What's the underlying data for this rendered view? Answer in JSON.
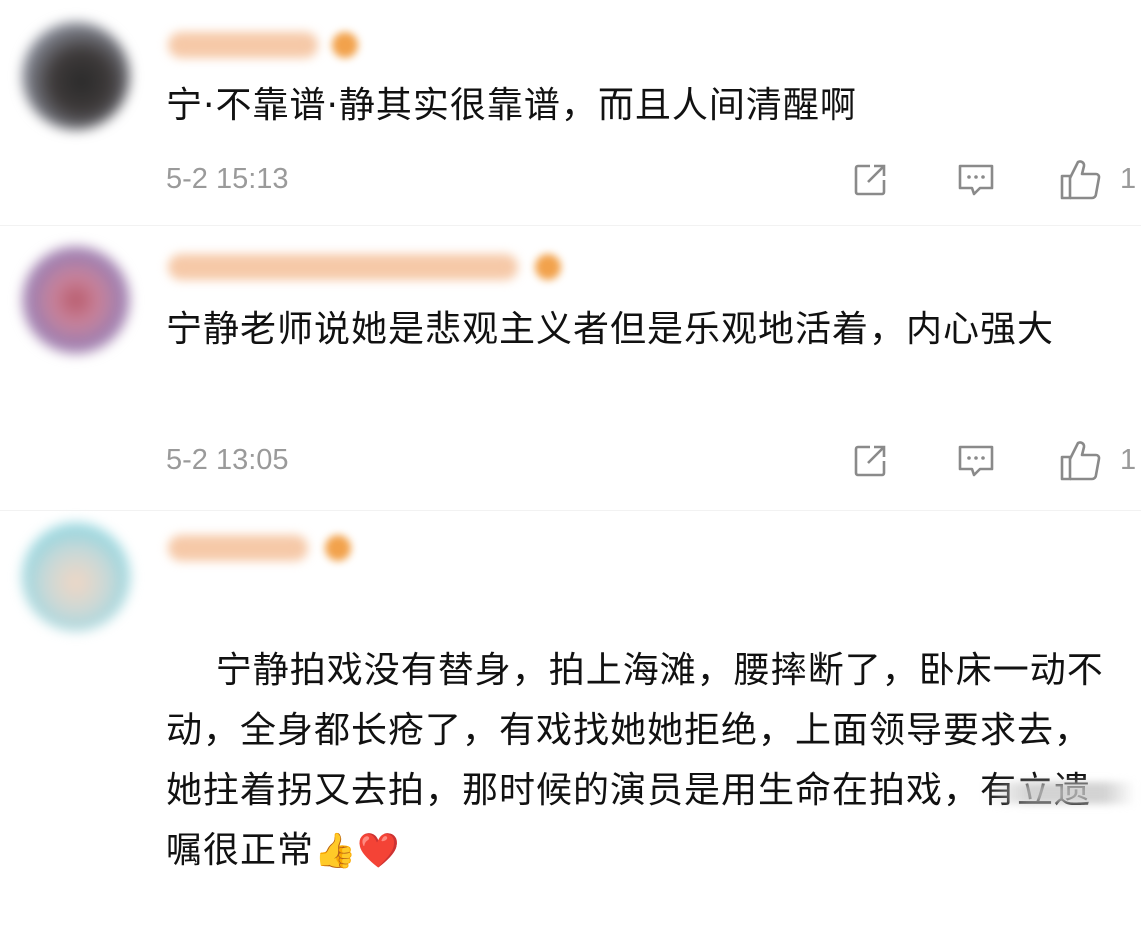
{
  "comments": [
    {
      "text": "宁·不靠谱·静其实很靠谱，而且人间清醒啊",
      "time": "5-2 15:13",
      "likes": "1"
    },
    {
      "text": "宁静老师说她是悲观主义者但是乐观地活着，内心强大",
      "time": "5-2 13:05",
      "likes": "1"
    },
    {
      "text": "宁静拍戏没有替身，拍上海滩，腰摔断了，卧床一动不动，全身都长疮了，有戏找她她拒绝，上面领导要求去，她拄着拐又去拍，那时候的演员是用生命在拍戏，有立遗嘱很正常",
      "emojis": "👍❤️"
    }
  ],
  "icons": {
    "share": "share-icon",
    "comment": "comment-icon",
    "like": "thumbs-up-icon"
  },
  "colors": {
    "meta_text": "#9a9a9a",
    "body_text": "#111111",
    "icon": "#8a8a8a"
  }
}
